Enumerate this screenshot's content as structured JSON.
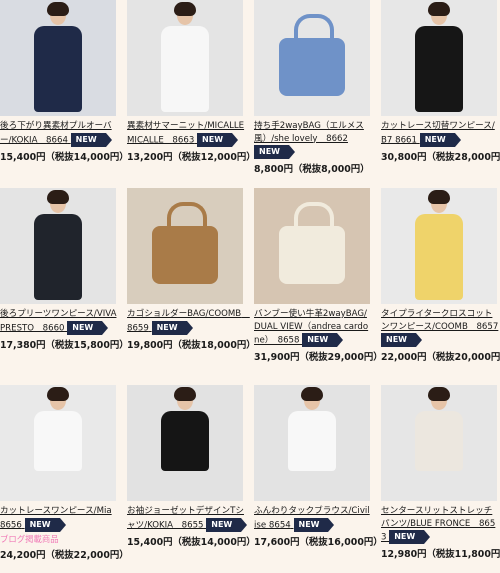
{
  "products": [
    {
      "name": "後ろ下がり異素材プルオーバー/KOKIA　8664",
      "badge": "NEW",
      "price": "15,400円（税抜14,000円）",
      "extra": "",
      "bg": "#d9dce2",
      "garment": "#1f2a48"
    },
    {
      "name": "異素材サマーニット/MICALLE MICALLE　8663",
      "badge": "NEW",
      "price": "13,200円（税抜12,000円）",
      "extra": "",
      "bg": "#e4e4e4",
      "garment": "#f7f7f7"
    },
    {
      "name": "持ち手2wayBAG（エルメス風）/she lovely　8662",
      "badge": "NEW",
      "price": "8,800円（税抜8,000円）",
      "extra": "",
      "bg": "#e6e6e6",
      "garment": "#6f92c8"
    },
    {
      "name": "カットレース切替ワンピース/B7 8661",
      "badge": "NEW",
      "price": "30,800円（税抜28,000円）",
      "extra": "",
      "bg": "#e7e7e7",
      "garment": "#161616"
    },
    {
      "name": "後ろプリーツワンピース/VIVA PRESTO　8660",
      "badge": "NEW",
      "price": "17,380円（税抜15,800円）",
      "extra": "",
      "bg": "#e4e4e4",
      "garment": "#20242c"
    },
    {
      "name": "カゴショルダーBAG/COOMB　8659",
      "badge": "NEW",
      "price": "19,800円（税抜18,000円）",
      "extra": "",
      "bg": "#d8cdbd",
      "garment": "#a97b48"
    },
    {
      "name": "バンブー使い牛革2wayBAG/DUAL VIEW（andrea cardone）　8658",
      "badge": "NEW",
      "price": "31,900円（税抜29,000円）",
      "extra": "",
      "bg": "#d6c5b2",
      "garment": "#f1ebdd"
    },
    {
      "name": "タイプライタークロスコットンワンピース/COOMB　8657",
      "badge": "NEW",
      "price": "22,000円（税抜20,000円）",
      "extra": "",
      "bg": "#e9e9e9",
      "garment": "#efd36a"
    },
    {
      "name": "カットレースワンピース/Mia 8656",
      "badge": "NEW",
      "price": "24,200円（税抜22,000円）",
      "extra": "ブログ掲載商品",
      "bg": "#e9e9e9",
      "garment": "#f8f8f8"
    },
    {
      "name": "お袖ジョーゼットデザインTシャツ/KOKIA　8655",
      "badge": "NEW",
      "price": "15,400円（税抜14,000円）",
      "extra": "",
      "bg": "#e2e2e2",
      "garment": "#151515"
    },
    {
      "name": "ふんわりタックブラウス/Civilise 8654",
      "badge": "NEW",
      "price": "17,600円（税抜16,000円）",
      "extra": "",
      "bg": "#e3e3e3",
      "garment": "#f8f8f8"
    },
    {
      "name": "センタースリットストレッチパンツ/BLUE FRONCE　8653",
      "badge": "NEW",
      "price": "12,980円（税抜11,800円）",
      "extra": "",
      "bg": "#e6e6e6",
      "garment": "#ece7df"
    }
  ]
}
